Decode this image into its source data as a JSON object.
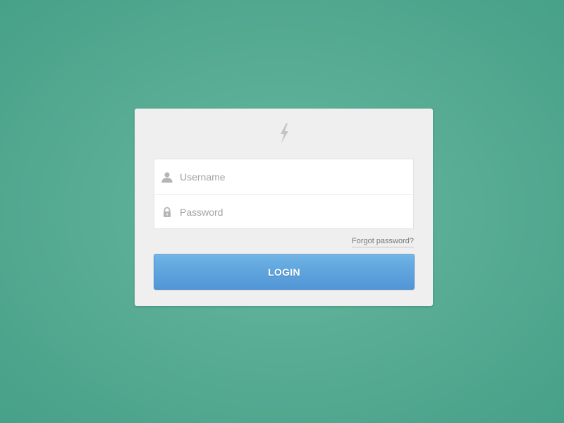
{
  "logo": {
    "icon": "lightning-bolt-icon"
  },
  "form": {
    "username": {
      "placeholder": "Username",
      "value": "",
      "icon": "user-icon"
    },
    "password": {
      "placeholder": "Password",
      "value": "",
      "icon": "lock-icon"
    },
    "forgot_label": "Forgot password?",
    "login_label": "LOGIN"
  },
  "colors": {
    "background": "#5aae95",
    "card": "#efefef",
    "button": "#5ea4dd"
  }
}
